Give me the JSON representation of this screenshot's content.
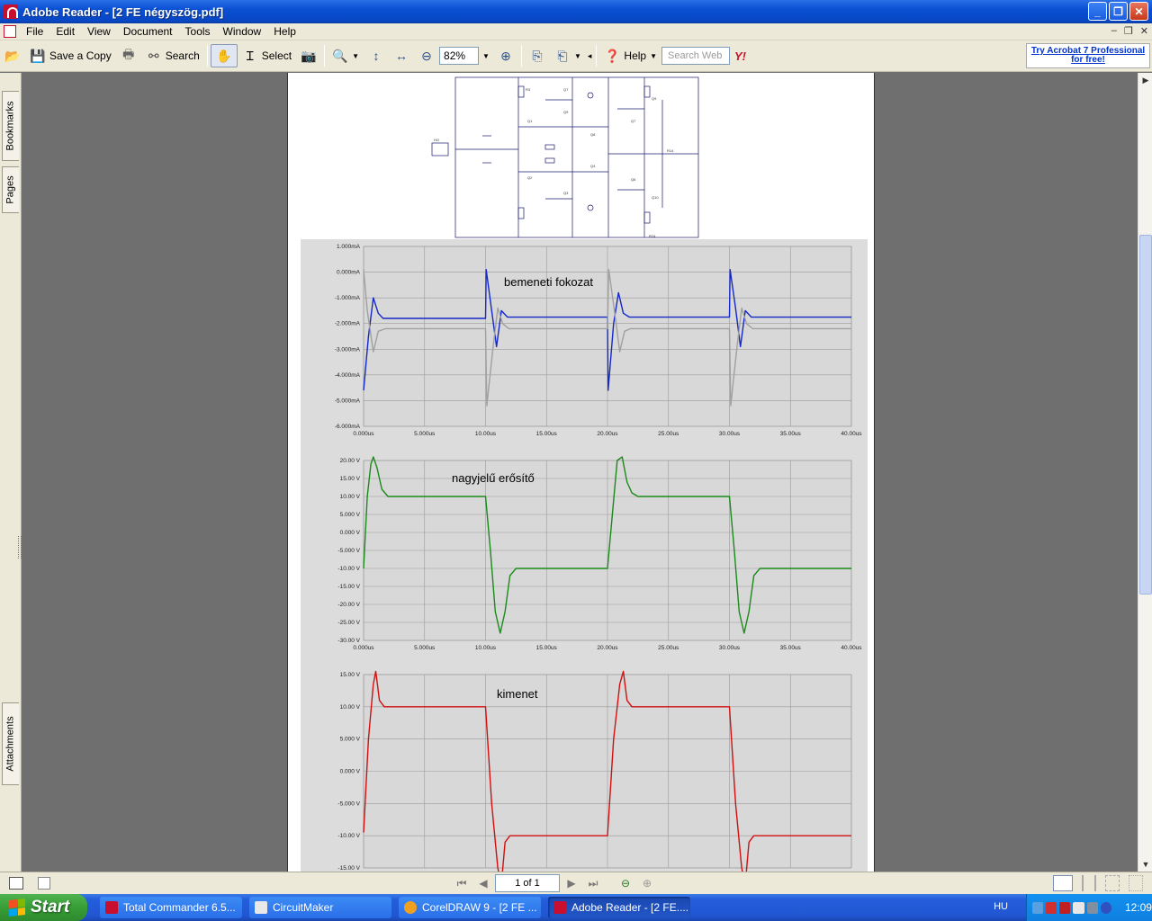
{
  "window": {
    "title": "Adobe Reader - [2 FE négyszög.pdf]"
  },
  "menu": [
    "File",
    "Edit",
    "View",
    "Document",
    "Tools",
    "Window",
    "Help"
  ],
  "toolbar": {
    "save_copy": "Save a Copy",
    "search": "Search",
    "select": "Select",
    "zoom_value": "82%",
    "help": "Help",
    "search_web_placeholder": "Search Web",
    "promo": "Try Acrobat 7 Professional for free!"
  },
  "nav_tabs": {
    "bookmarks": "Bookmarks",
    "pages": "Pages",
    "attachments": "Attachments"
  },
  "page_nav": {
    "page_indicator": "1 of 1"
  },
  "plots": [
    {
      "label": "bemeneti fokozat",
      "yticks": [
        "1.000mA",
        "0.000mA",
        "-1.000mA",
        "-2.000mA",
        "-3.000mA",
        "-4.000mA",
        "-5.000mA",
        "-6.000mA"
      ],
      "xticks": [
        "0.000us",
        "5.000us",
        "10.00us",
        "15.00us",
        "20.00us",
        "25.00us",
        "30.00us",
        "35.00us",
        "40.00us"
      ]
    },
    {
      "label": "nagyjelű erősítő",
      "yticks": [
        "20.00 V",
        "15.00 V",
        "10.00 V",
        "5.000 V",
        "0.000 V",
        "-5.000 V",
        "-10.00 V",
        "-15.00 V",
        "-20.00 V",
        "-25.00 V",
        "-30.00 V"
      ],
      "xticks": [
        "0.000us",
        "5.000us",
        "10.00us",
        "15.00us",
        "20.00us",
        "25.00us",
        "30.00us",
        "35.00us",
        "40.00us"
      ]
    },
    {
      "label": "kimenet",
      "yticks": [
        "15.00 V",
        "10.00 V",
        "5.000 V",
        "0.000 V",
        "-5.000 V",
        "-10.00 V",
        "-15.00 V"
      ],
      "xticks": []
    }
  ],
  "chart_data": [
    {
      "type": "line",
      "title": "bemeneti fokozat",
      "xlim": [
        0,
        40
      ],
      "ylim": [
        -6,
        1
      ],
      "series": [
        {
          "color": "#1428c8",
          "x": [
            0,
            0.4,
            0.8,
            1.2,
            1.6,
            2.2,
            10,
            10.05,
            10.5,
            10.9,
            11.3,
            11.8,
            12.2,
            20,
            20.05,
            20.5,
            20.9,
            21.3,
            21.8,
            22.2,
            30,
            30.05,
            30.5,
            30.9,
            31.3,
            31.8,
            32.2,
            40
          ],
          "y": [
            -4.6,
            -2.5,
            -1.0,
            -1.6,
            -1.8,
            -1.8,
            -1.8,
            0.1,
            -1.5,
            -2.9,
            -1.5,
            -1.75,
            -1.75,
            -1.75,
            -4.6,
            -2.0,
            -0.8,
            -1.6,
            -1.75,
            -1.75,
            -1.75,
            0.1,
            -1.4,
            -2.9,
            -1.5,
            -1.75,
            -1.75,
            -1.75
          ]
        },
        {
          "color": "#a0a0a0",
          "x": [
            0,
            0.3,
            0.8,
            1.2,
            1.8,
            2.4,
            10,
            10.1,
            10.6,
            11.0,
            11.4,
            11.9,
            12.4,
            20,
            20.1,
            20.6,
            21.0,
            21.4,
            21.9,
            22.4,
            30,
            30.1,
            30.6,
            31.0,
            31.4,
            31.9,
            32.4,
            40
          ],
          "y": [
            0.1,
            -1.5,
            -3.1,
            -2.3,
            -2.2,
            -2.2,
            -2.2,
            -5.2,
            -3.0,
            -1.4,
            -2.0,
            -2.2,
            -2.2,
            -2.2,
            0.1,
            -1.6,
            -3.1,
            -2.3,
            -2.2,
            -2.2,
            -2.2,
            -5.2,
            -3.0,
            -1.4,
            -2.0,
            -2.2,
            -2.2,
            -2.2
          ]
        }
      ]
    },
    {
      "type": "line",
      "title": "nagyjelű erősítő",
      "xlim": [
        0,
        40
      ],
      "ylim": [
        -30,
        22
      ],
      "series": [
        {
          "color": "#1a8a1a",
          "x": [
            0,
            0.3,
            0.6,
            0.8,
            1.1,
            1.5,
            2.0,
            2.5,
            10,
            10.4,
            10.8,
            11.2,
            11.6,
            12.0,
            12.5,
            13,
            20,
            20.4,
            20.8,
            21.2,
            21.6,
            22.0,
            22.5,
            23,
            30,
            30.4,
            30.8,
            31.2,
            31.6,
            32.0,
            32.5,
            33,
            40
          ],
          "y": [
            -10,
            10,
            19,
            21,
            18,
            12,
            10,
            10,
            10,
            -5,
            -22,
            -28,
            -22,
            -12,
            -10,
            -10,
            -10,
            5,
            20,
            21,
            14,
            11,
            10,
            10,
            10,
            -5,
            -22,
            -28,
            -22,
            -12,
            -10,
            -10,
            -10
          ]
        }
      ]
    },
    {
      "type": "line",
      "title": "kimenet",
      "xlim": [
        0,
        40
      ],
      "ylim": [
        -18,
        16
      ],
      "series": [
        {
          "color": "#d01010",
          "x": [
            0,
            0.4,
            0.8,
            1.0,
            1.3,
            1.7,
            2.2,
            10,
            10.5,
            11.0,
            11.3,
            11.6,
            12.0,
            12.5,
            20,
            20.5,
            21.0,
            21.3,
            21.6,
            22.0,
            22.5,
            30,
            30.5,
            31.0,
            31.3,
            31.6,
            32.0,
            32.5,
            40
          ],
          "y": [
            -9.5,
            5,
            13.5,
            15.5,
            11,
            10,
            10,
            10,
            -5,
            -15,
            -17.5,
            -11,
            -10,
            -10,
            -10,
            5,
            13.5,
            15.5,
            11,
            10,
            10,
            10,
            -5,
            -15,
            -17.5,
            -11,
            -10,
            -10,
            -10
          ]
        }
      ]
    }
  ],
  "taskbar": {
    "start": "Start",
    "tasks": [
      "Total Commander 6.5...",
      "CircuitMaker",
      "CorelDRAW 9 - [2 FE ...",
      "Adobe Reader - [2 FE...."
    ],
    "lang": "HU",
    "clock": "12:09"
  }
}
